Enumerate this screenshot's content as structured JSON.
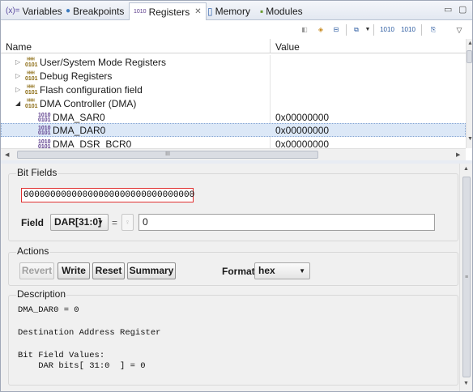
{
  "tabs": [
    {
      "label": "Variables",
      "icon": "variables-icon",
      "glyph": "(x)="
    },
    {
      "label": "Breakpoints",
      "icon": "breakpoints-icon",
      "glyph": "●"
    },
    {
      "label": "Registers",
      "icon": "registers-icon",
      "glyph": "1010",
      "active": true
    },
    {
      "label": "Memory",
      "icon": "memory-icon",
      "glyph": "▯"
    },
    {
      "label": "Modules",
      "icon": "modules-icon",
      "glyph": "▪"
    }
  ],
  "tab_close_glyph": "✕",
  "window": {
    "minimize": "▭",
    "maximize": "▢"
  },
  "table": {
    "headers": {
      "name": "Name",
      "value": "Value"
    },
    "rows": [
      {
        "name": "User/System Mode Registers",
        "value": "",
        "expander": "▷",
        "group": true
      },
      {
        "name": "Debug Registers",
        "value": "",
        "expander": "▷",
        "group": true
      },
      {
        "name": "Flash configuration field",
        "value": "",
        "expander": "▷",
        "group": true
      },
      {
        "name": "DMA Controller (DMA)",
        "value": "",
        "expander": "◢",
        "group": true
      },
      {
        "name": "DMA_SAR0",
        "value": "0x00000000",
        "expander": "",
        "group": false
      },
      {
        "name": "DMA_DAR0",
        "value": "0x00000000",
        "expander": "",
        "group": false,
        "selected": true
      },
      {
        "name": "DMA_DSR_BCR0",
        "value": "0x00000000",
        "expander": "",
        "group": false
      }
    ],
    "hscroll_grip": "III"
  },
  "bit_fields": {
    "title": "Bit Fields",
    "bits": "00000000000000000000000000000000",
    "field_label": "Field",
    "field_value": "DAR[31:0]",
    "equals": "=",
    "value": "0"
  },
  "actions": {
    "title": "Actions",
    "revert": "Revert",
    "write": "Write",
    "reset": "Reset",
    "summary": "Summary",
    "format_label": "Format",
    "format_value": "hex"
  },
  "description": {
    "title": "Description",
    "lines": [
      "DMA_DAR0 = 0",
      "",
      "Destination Address Register",
      "",
      "Bit Field Values:",
      "    DAR bits[ 31:0  ] = 0"
    ]
  },
  "colors": {
    "selection": "#dce8f7",
    "bits_border": "#e03030",
    "accent": "#2a5aa0"
  }
}
